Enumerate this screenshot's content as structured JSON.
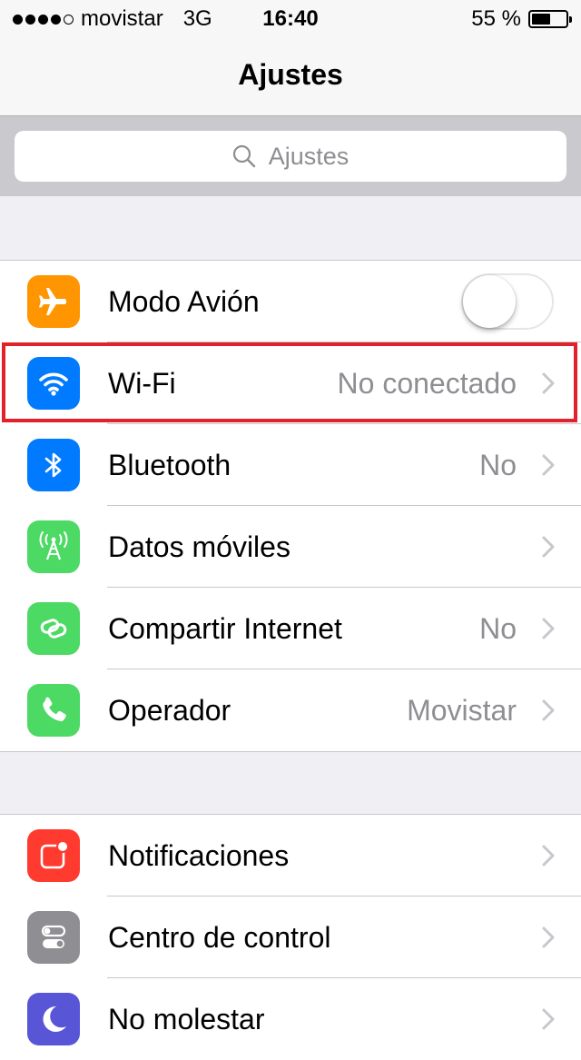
{
  "status_bar": {
    "carrier": "movistar",
    "network": "3G",
    "time": "16:40",
    "battery": "55 %",
    "battery_level": 0.55,
    "signal_bars": 4,
    "signal_max": 5
  },
  "nav": {
    "title": "Ajustes"
  },
  "search": {
    "placeholder": "Ajustes",
    "icon": "search-icon"
  },
  "groups": [
    {
      "rows": [
        {
          "label": "Modo Avión",
          "icon": "airplane-icon",
          "icon_color": "#ff9500",
          "toggle": false
        },
        {
          "label": "Wi-Fi",
          "value": "No conectado",
          "icon": "wifi-icon",
          "icon_color": "#007aff",
          "highlighted": true
        },
        {
          "label": "Bluetooth",
          "value": "No",
          "icon": "bluetooth-icon",
          "icon_color": "#007aff"
        },
        {
          "label": "Datos móviles",
          "value": "",
          "icon": "antenna-icon",
          "icon_color": "#4cd964"
        },
        {
          "label": "Compartir Internet",
          "value": "No",
          "icon": "link-icon",
          "icon_color": "#4cd964"
        },
        {
          "label": "Operador",
          "value": "Movistar",
          "icon": "phone-icon",
          "icon_color": "#4cd964"
        }
      ]
    },
    {
      "rows": [
        {
          "label": "Notificaciones",
          "icon": "notifications-icon",
          "icon_color": "#ff3b30"
        },
        {
          "label": "Centro de control",
          "icon": "control-center-icon",
          "icon_color": "#8e8e93"
        },
        {
          "label": "No molestar",
          "icon": "moon-icon",
          "icon_color": "#5856d6"
        }
      ]
    }
  ],
  "colors": {
    "highlight": "#e3212b",
    "chevron": "#c7c7cc"
  }
}
